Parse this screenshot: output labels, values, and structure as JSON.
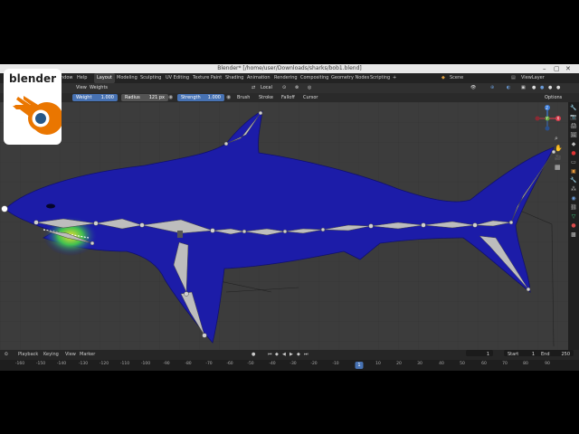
{
  "window": {
    "title": "Blender* [/home/user/Downloads/sharks/bob1.blend]"
  },
  "logo": {
    "text": "blender"
  },
  "menu": {
    "items": [
      "ndow",
      "Help"
    ],
    "workspaces": [
      "Layout",
      "Modeling",
      "Sculpting",
      "UV Editing",
      "Texture Paint",
      "Shading",
      "Animation",
      "Rendering",
      "Compositing",
      "Geometry Nodes",
      "Scripting"
    ],
    "add_tab": "+",
    "scene": "Scene",
    "view_layer": "ViewLayer"
  },
  "header": {
    "view": "View",
    "weights": "Weights",
    "orientation": "Local",
    "options": "Options"
  },
  "tool_settings": {
    "weight_label": "Weight",
    "weight_value": "1.000",
    "radius_label": "Radius",
    "radius_value": "121 px",
    "strength_label": "Strength",
    "strength_value": "1.000",
    "brush": "Brush",
    "stroke": "Stroke",
    "falloff": "Falloff",
    "cursor": "Cursor"
  },
  "gizmo": {
    "z": "Z",
    "y": "Y",
    "x": "X"
  },
  "timeline": {
    "playback": "Playback",
    "keying": "Keying",
    "view": "View",
    "marker": "Marker",
    "current_frame": "1",
    "start_label": "Start",
    "start_value": "1",
    "end_label": "End",
    "end_value": "250",
    "ruler": [
      "-160",
      "-150",
      "-140",
      "-130",
      "-120",
      "-110",
      "-100",
      "-90",
      "-80",
      "-70",
      "-60",
      "-50",
      "-40",
      "-30",
      "-20",
      "-10",
      "0",
      "10",
      "20",
      "30",
      "40",
      "50",
      "60",
      "70",
      "80",
      "90"
    ],
    "indicator": "1"
  },
  "colors": {
    "shark_body": "#1c1ca8",
    "bone": "#b9b9b9",
    "accent": "#4772b3",
    "viewport_bg": "#3c3c3c"
  }
}
